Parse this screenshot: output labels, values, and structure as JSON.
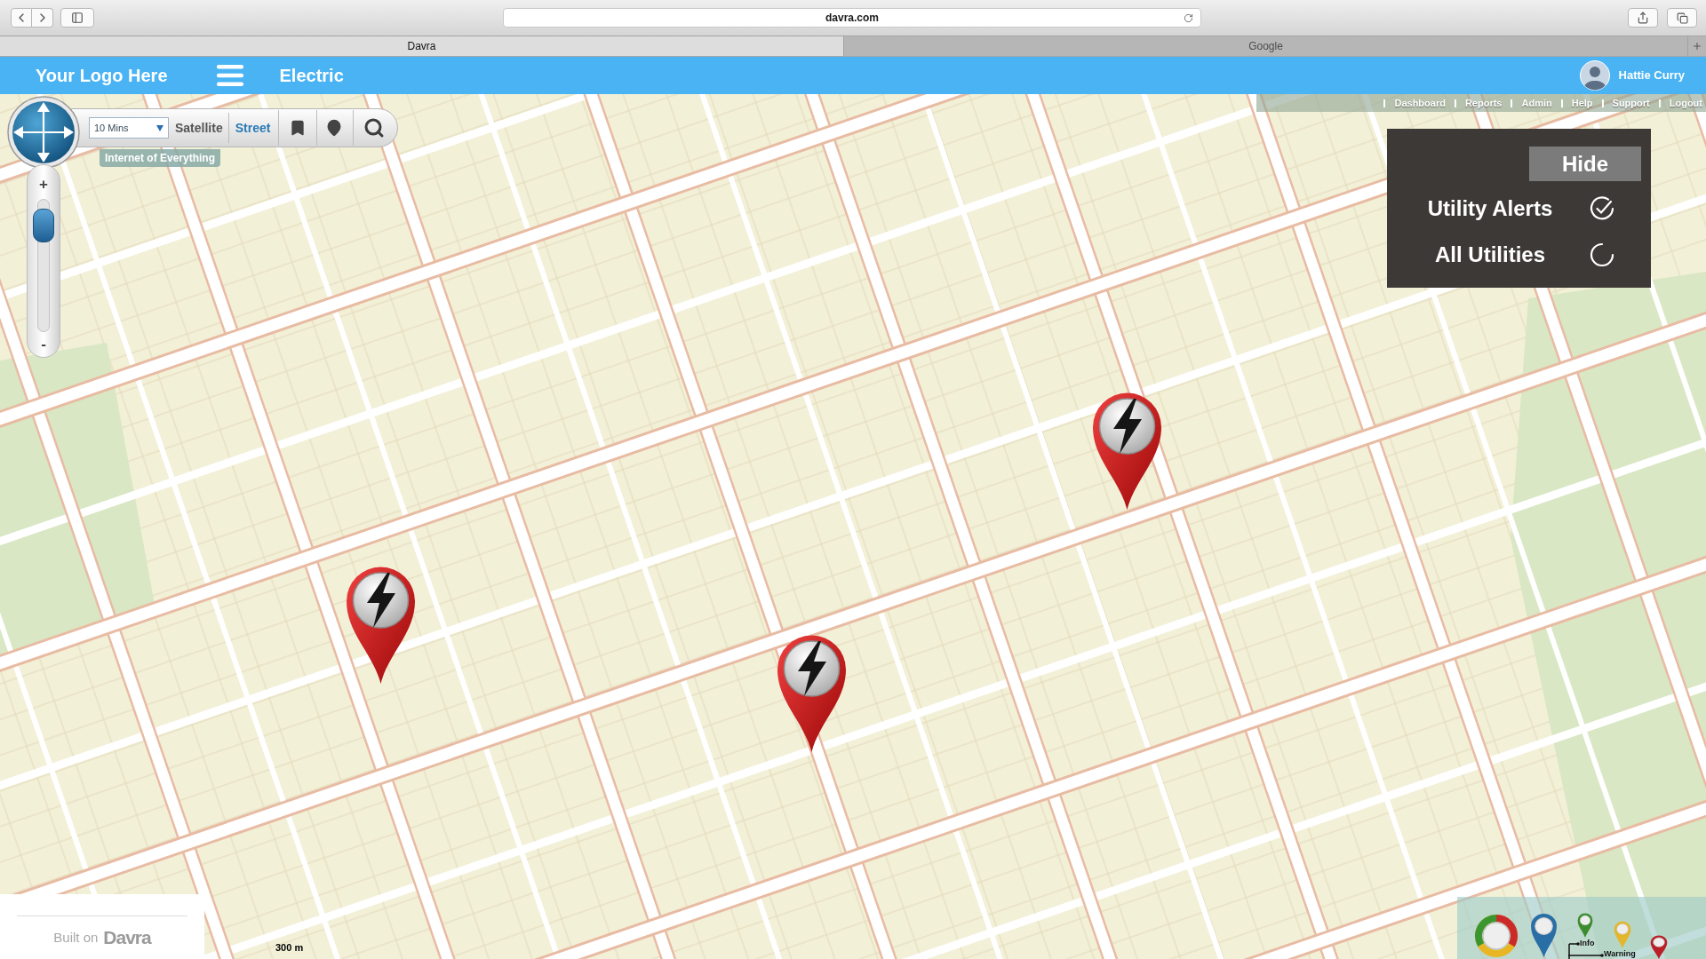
{
  "browser": {
    "url": "davra.com",
    "tabs": [
      {
        "label": "Davra",
        "selected": true
      },
      {
        "label": "Google",
        "selected": false
      }
    ]
  },
  "header": {
    "logo": "Your Logo Here",
    "title": "Electric",
    "user_name": "Hattie Curry"
  },
  "nav_links": [
    "Dashboard",
    "Reports",
    "Admin",
    "Help",
    "Support",
    "Logout"
  ],
  "map_toolbar": {
    "interval": "10 Mins",
    "layers": [
      {
        "label": "Satellite",
        "selected": false
      },
      {
        "label": "Street",
        "selected": true
      }
    ],
    "tag": "Internet of Everything"
  },
  "zoom_slider": {
    "zoom_in": "+",
    "zoom_out": "-",
    "level": 0.9
  },
  "layers_panel": {
    "hide_button": "Hide",
    "items": [
      {
        "label": "Utility Alerts",
        "checked": true
      },
      {
        "label": "All Utilities",
        "checked": false
      }
    ]
  },
  "markers": [
    {
      "kind": "electric"
    },
    {
      "kind": "electric"
    },
    {
      "kind": "electric"
    }
  ],
  "scale": "300 m",
  "legend": {
    "pins": [
      {
        "color": "#2a6ea6"
      },
      {
        "label": "Info",
        "color": "#3c8d2f"
      },
      {
        "label": "Warning",
        "color": "#e3b62c"
      },
      {
        "color": "#b92028"
      }
    ]
  },
  "footer": {
    "prefix": "Built on",
    "brand": "Davra"
  }
}
